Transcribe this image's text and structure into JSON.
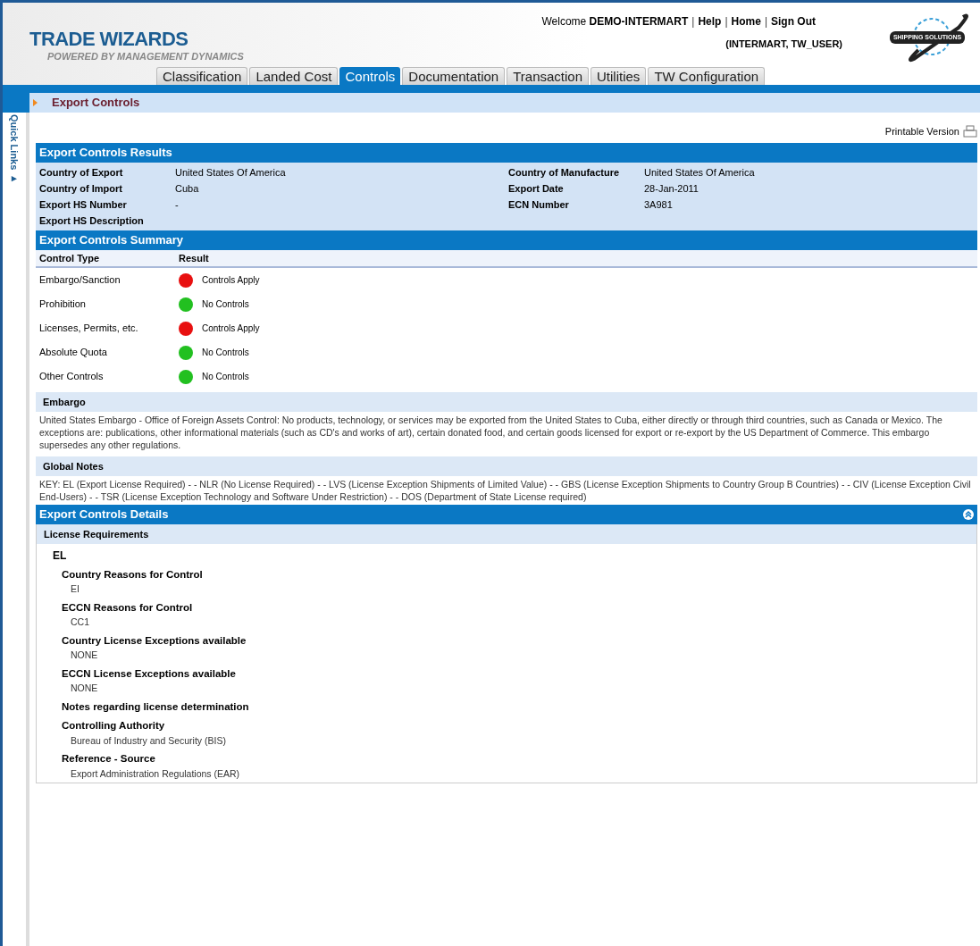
{
  "brand": {
    "title": "TRADE WIZARDS",
    "subtitle": "POWERED BY MANAGEMENT DYNAMICS",
    "logo_text": "SHIPPING SOLUTIONS"
  },
  "user_bar": {
    "welcome": "Welcome",
    "user": "DEMO-INTERMART",
    "separator": "|",
    "links": [
      "Help",
      "Home",
      "Sign Out"
    ],
    "account": "(INTERMART, TW_USER)"
  },
  "tabs": [
    {
      "label": "Classification",
      "selected": false
    },
    {
      "label": "Landed Cost",
      "selected": false
    },
    {
      "label": "Controls",
      "selected": true
    },
    {
      "label": "Documentation",
      "selected": false
    },
    {
      "label": "Transaction",
      "selected": false
    },
    {
      "label": "Utilities",
      "selected": false
    },
    {
      "label": "TW Configuration",
      "selected": false
    }
  ],
  "breadcrumb": "Export Controls",
  "quick_links": "Quick Links ▸",
  "printable_version": "Printable Version",
  "results": {
    "title": "Export Controls Results",
    "left": [
      {
        "label": "Country of Export",
        "value": "United States Of America"
      },
      {
        "label": "Country of Import",
        "value": "Cuba"
      },
      {
        "label": "Export HS Number",
        "value": "-"
      },
      {
        "label": "Export HS Description"
      }
    ],
    "right": [
      {
        "label": "Country of Manufacture",
        "value": "United States Of America"
      },
      {
        "label": "Export Date",
        "value": "28-Jan-2011"
      },
      {
        "label": "ECN Number",
        "value": "3A981"
      }
    ]
  },
  "summary": {
    "title": "Export Controls Summary",
    "columns": [
      "Control Type",
      "Result"
    ],
    "rows": [
      {
        "type": "Embargo/Sanction",
        "result": "Controls Apply",
        "color": "#e81010"
      },
      {
        "type": "Prohibition",
        "result": "No Controls",
        "color": "#22c020"
      },
      {
        "type": "Licenses, Permits, etc.",
        "result": "Controls Apply",
        "color": "#e81010"
      },
      {
        "type": "Absolute Quota",
        "result": "No Controls",
        "color": "#22c020"
      },
      {
        "type": "Other Controls",
        "result": "No Controls",
        "color": "#22c020"
      }
    ]
  },
  "notes": [
    {
      "heading": "Embargo",
      "text": "United States Embargo - Office of Foreign Assets Control: No products, technology, or services may be exported from the United States to Cuba, either directly or through third countries, such as Canada or Mexico. The exceptions are: publications, other informational materials (such as CD's and works of art), certain donated food, and certain goods licensed for export or re-export by the US Department of Commerce. This embargo supersedes any other regulations."
    },
    {
      "heading": "Global Notes",
      "text": "KEY: EL (Export License Required) - - NLR (No License Required) - - LVS (License Exception Shipments of Limited Value) - - GBS (License Exception Shipments to Country Group B Countries) - - CIV (License Exception Civil End-Users) - - TSR (License Exception Technology and Software Under Restriction) - - DOS (Department of State License required)"
    }
  ],
  "details": {
    "title": "Export Controls Details",
    "section": "License Requirements",
    "code": "EL",
    "items": [
      {
        "label": "Country Reasons for Control",
        "value": "EI"
      },
      {
        "label": "ECCN Reasons for Control",
        "value": "CC1"
      },
      {
        "label": "Country License Exceptions available",
        "value": "NONE"
      },
      {
        "label": "ECCN License Exceptions available",
        "value": "NONE"
      },
      {
        "label": "Notes regarding license determination"
      },
      {
        "label": "Controlling Authority",
        "value": "Bureau of Industry and Security (BIS)"
      },
      {
        "label": "Reference - Source",
        "value": "Export Administration Regulations (EAR)"
      }
    ]
  }
}
